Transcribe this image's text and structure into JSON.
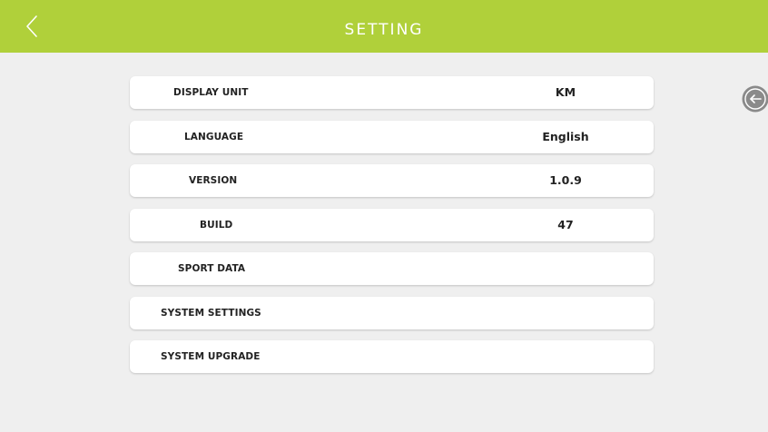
{
  "header": {
    "title": "SETTING",
    "back_icon": "chevron-left-icon",
    "bg_color": "#b0d03a"
  },
  "settings": {
    "display_unit": {
      "label": "DISPLAY UNIT",
      "value": "KM"
    },
    "language": {
      "label": "LANGUAGE",
      "value": "English"
    },
    "version": {
      "label": "VERSION",
      "value": "1.0.9"
    },
    "build": {
      "label": "BUILD",
      "value": "47"
    },
    "sport_data": {
      "label": "SPORT DATA"
    },
    "system_settings": {
      "label": "SYSTEM SETTINGS"
    },
    "system_upgrade": {
      "label": "SYSTEM UPGRADE"
    }
  },
  "side_button": {
    "icon": "arrow-left-circle-icon",
    "color": "#8a8a8a"
  }
}
